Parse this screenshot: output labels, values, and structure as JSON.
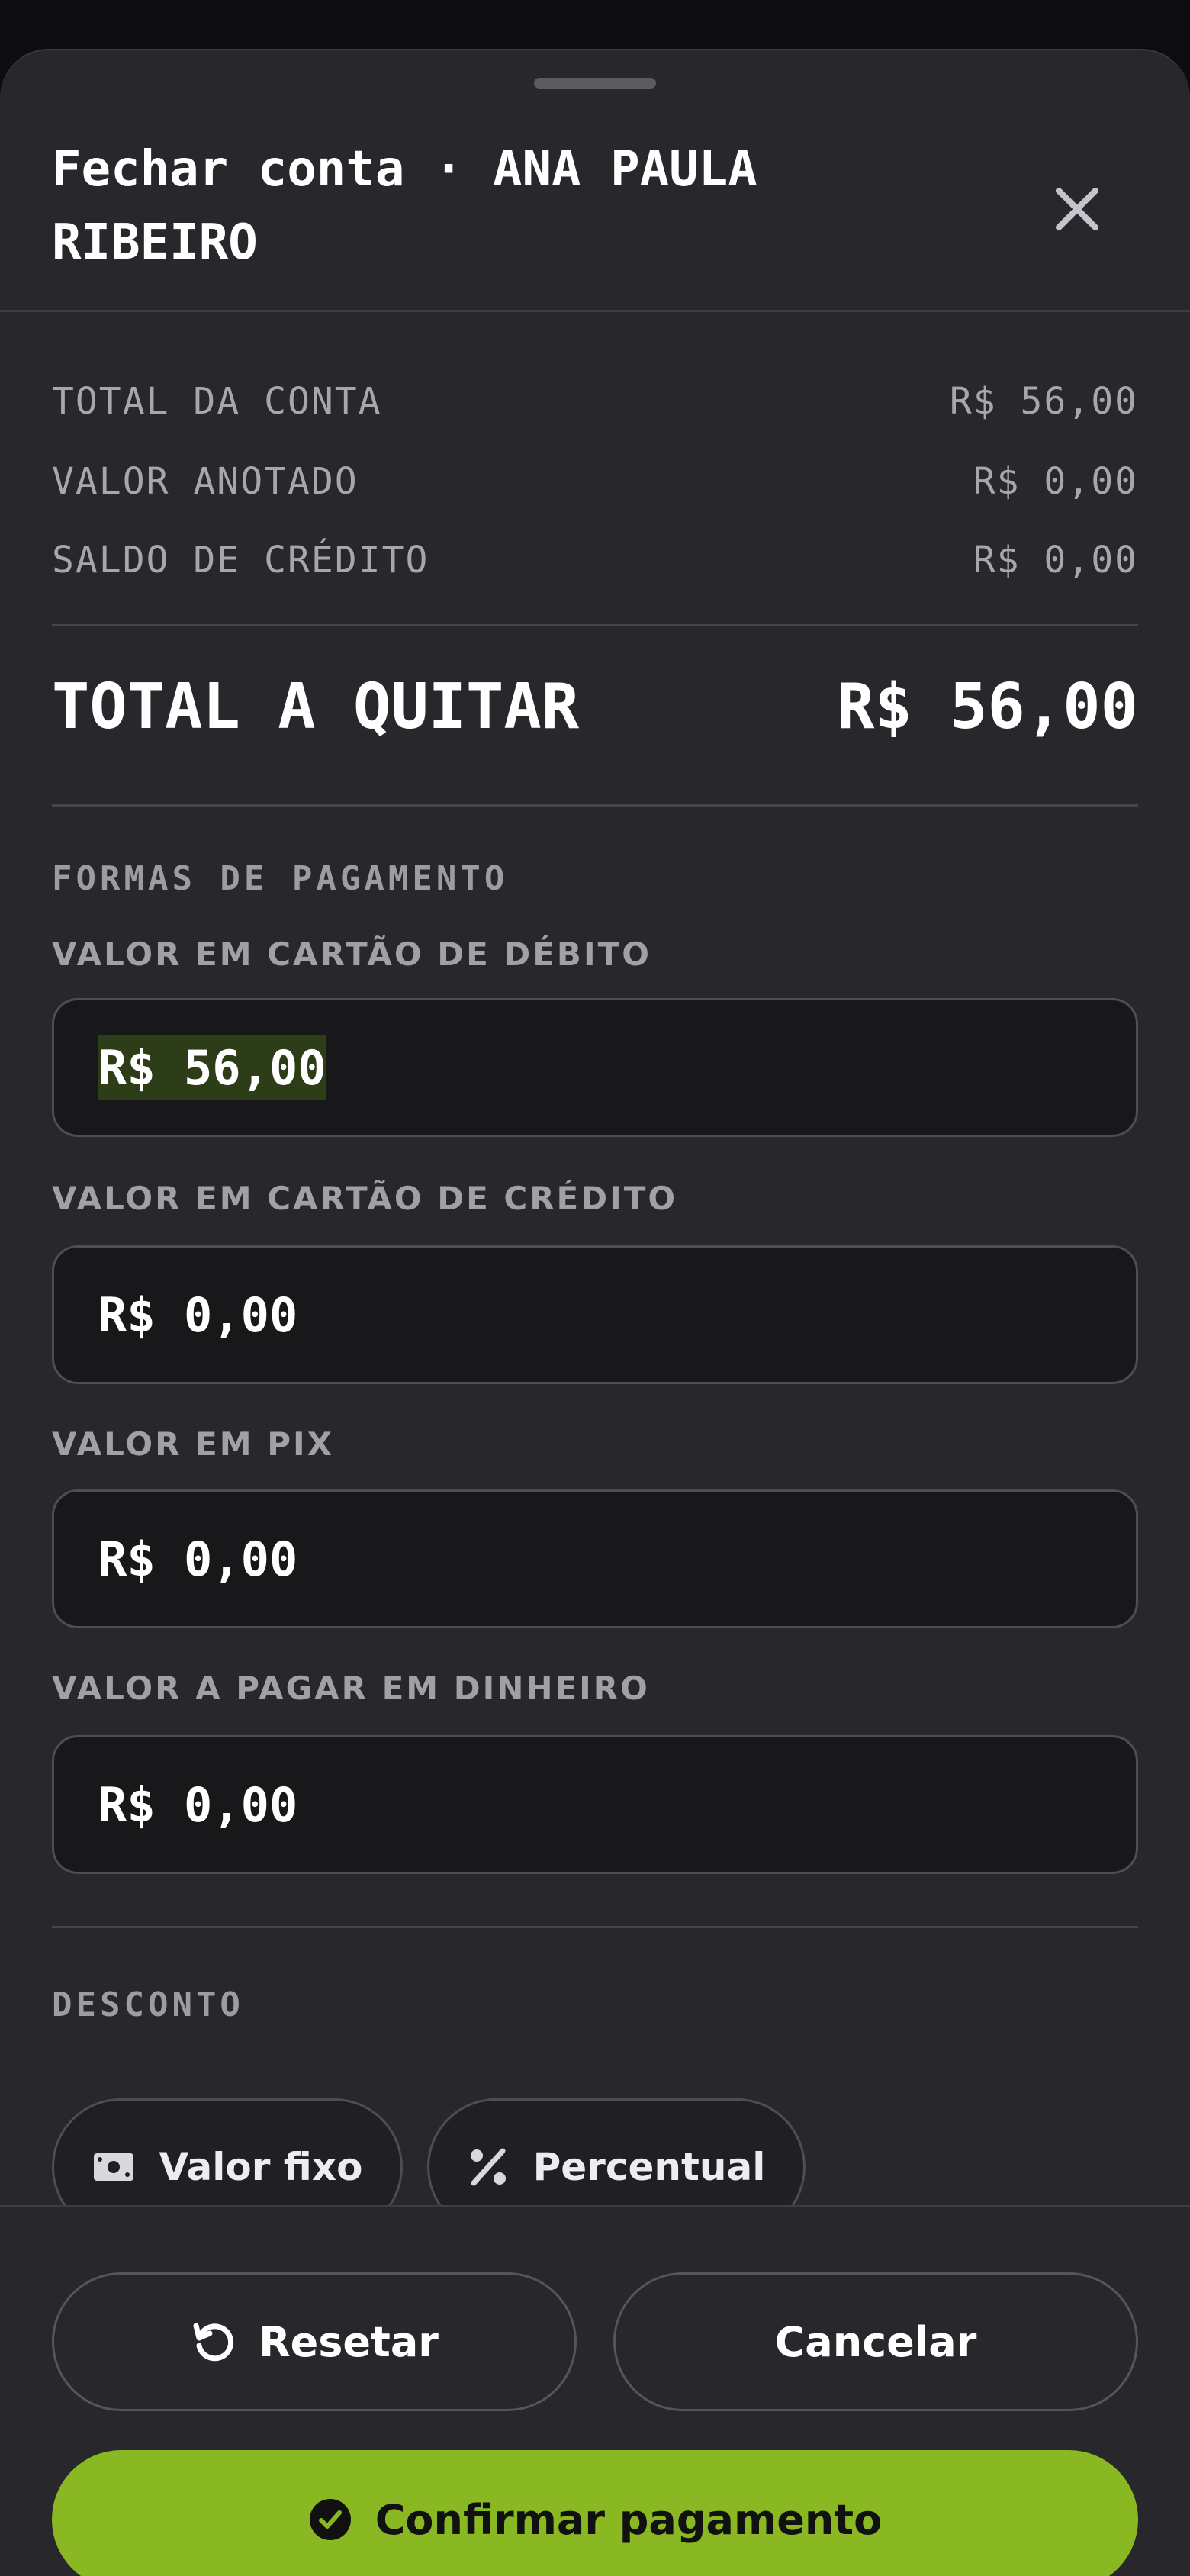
{
  "sheet": {
    "title": "Fechar conta · ANA PAULA RIBEIRO"
  },
  "summary": {
    "total_conta_label": "TOTAL DA CONTA",
    "total_conta_value": "R$ 56,00",
    "valor_anotado_label": "VALOR ANOTADO",
    "valor_anotado_value": "R$ 0,00",
    "saldo_credito_label": "SALDO DE CRÉDITO",
    "saldo_credito_value": "R$ 0,00",
    "total_quitar_label": "TOTAL A QUITAR",
    "total_quitar_value": "R$ 56,00"
  },
  "payment": {
    "section_label": "FORMAS DE PAGAMENTO",
    "fields": [
      {
        "label": "VALOR EM CARTÃO DE DÉBITO",
        "value": "R$ 56,00"
      },
      {
        "label": "VALOR EM CARTÃO DE CRÉDITO",
        "value": "R$ 0,00"
      },
      {
        "label": "VALOR EM PIX",
        "value": "R$ 0,00"
      },
      {
        "label": "VALOR A PAGAR EM DINHEIRO",
        "value": "R$ 0,00"
      }
    ]
  },
  "discount": {
    "section_label": "DESCONTO",
    "fixed_label": "Valor fixo",
    "percent_label": "Percentual"
  },
  "footer": {
    "reset_label": "Resetar",
    "cancel_label": "Cancelar",
    "confirm_label": "Confirmar pagamento"
  },
  "colors": {
    "accent": "#8ab823",
    "background": "#28282c",
    "field_background": "#18181b"
  },
  "icons": {
    "close": "close-icon",
    "fixed": "cash-icon",
    "percent": "percent-icon",
    "reset": "reset-icon",
    "confirm": "check-circle-icon"
  }
}
